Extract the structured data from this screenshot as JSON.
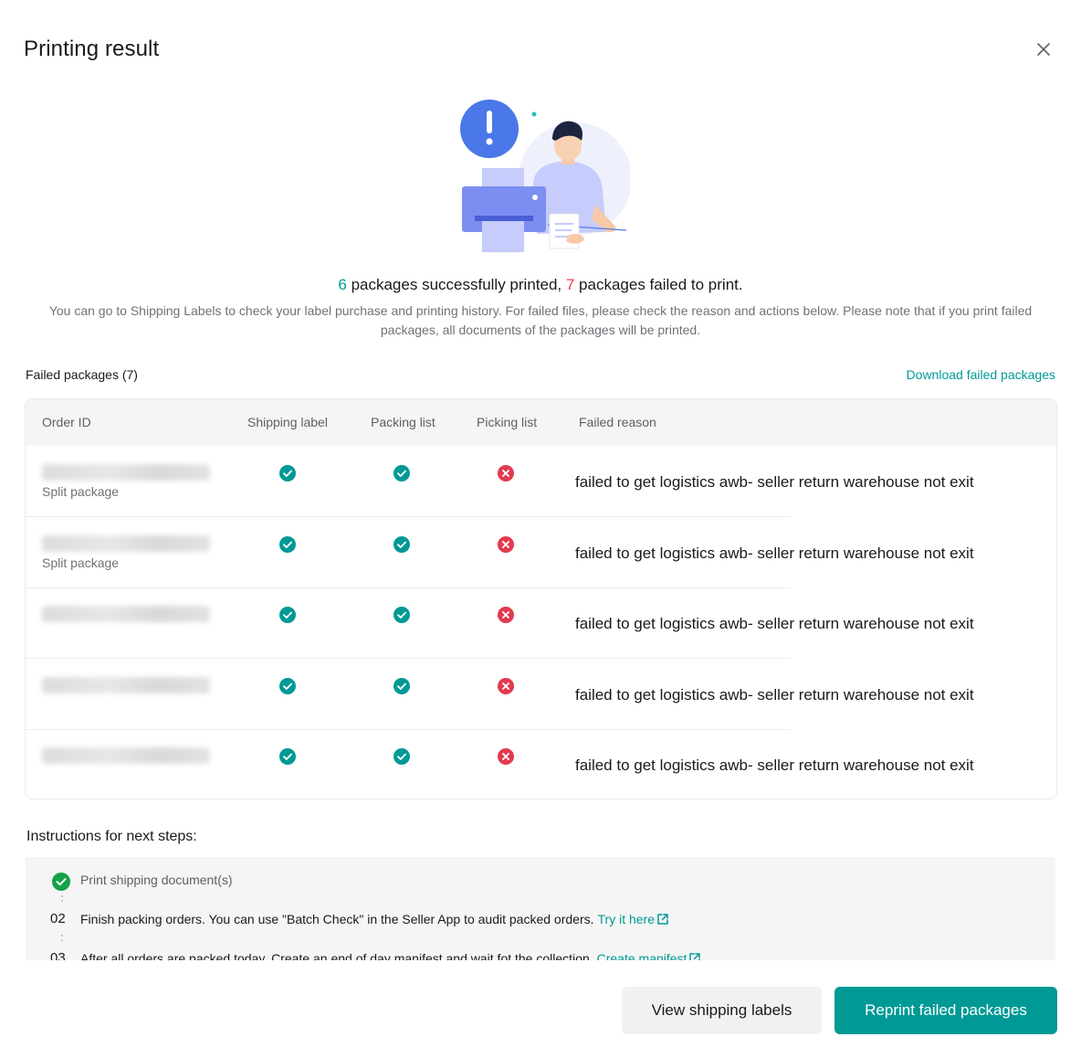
{
  "dialog": {
    "title": "Printing result"
  },
  "summary": {
    "success_count": "6",
    "success_text": " packages successfully printed, ",
    "failed_count": "7",
    "failed_text": " packages failed to print.",
    "description": "You can go to Shipping Labels to check your label purchase and printing history. For failed files, please check the reason and actions below. Please note that if you print failed packages, all documents of the packages will be printed."
  },
  "failed_section": {
    "heading": "Failed packages (7)",
    "download_label": "Download failed packages"
  },
  "table": {
    "columns": [
      "Order ID",
      "Shipping label",
      "Packing list",
      "Picking list",
      "Failed reason"
    ],
    "rows": [
      {
        "tag": "Split package",
        "shipping_label": "success",
        "packing_list": "success",
        "picking_list": "failed",
        "reason": "failed to get logistics awb- seller return warehouse not exit"
      },
      {
        "tag": "Split package",
        "shipping_label": "success",
        "packing_list": "success",
        "picking_list": "failed",
        "reason": "failed to get logistics awb- seller return warehouse not exit"
      },
      {
        "tag": "",
        "shipping_label": "success",
        "packing_list": "success",
        "picking_list": "failed",
        "reason": "failed to get logistics awb- seller return warehouse not exit"
      },
      {
        "tag": "",
        "shipping_label": "success",
        "packing_list": "success",
        "picking_list": "failed",
        "reason": "failed to get logistics awb- seller return warehouse not exit"
      },
      {
        "tag": "",
        "shipping_label": "success",
        "packing_list": "success",
        "picking_list": "failed",
        "reason": "failed to get logistics awb- seller return warehouse not exit"
      }
    ]
  },
  "instructions": {
    "heading": "Instructions for next steps:",
    "steps": [
      {
        "number": "",
        "status": "done",
        "text": "Print shipping document(s)",
        "link": ""
      },
      {
        "number": "02",
        "status": "pending",
        "text": "Finish packing orders. You can use \"Batch Check\" in the Seller App to audit packed orders.",
        "link": "Try it here"
      },
      {
        "number": "03",
        "status": "pending",
        "text": "After all orders are packed today. Create an end of day manifest and wait fot the collection.",
        "link": "Create manifest"
      }
    ]
  },
  "footer": {
    "secondary_label": "View shipping labels",
    "primary_label": "Reprint failed packages"
  },
  "colors": {
    "accent": "#009995",
    "success": "#009995",
    "error": "#f0354b",
    "done_step": "#14a346"
  },
  "icons": {
    "close": "close-icon",
    "success": "check-circle-icon",
    "failed": "x-circle-icon",
    "external": "external-link-icon",
    "step_done": "check-circle-icon"
  }
}
